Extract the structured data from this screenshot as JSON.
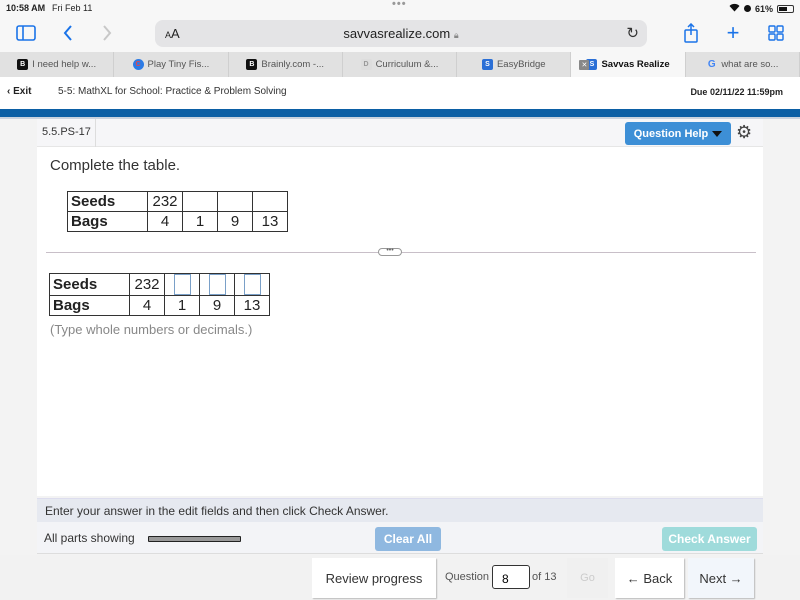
{
  "status_bar": {
    "time": "10:58 AM",
    "date": "Fri Feb 11",
    "battery": "61%",
    "battery_level": 0.61
  },
  "browser": {
    "text_size_label": "AA",
    "url": "savvasrealize.com",
    "icons": {
      "sidebar": "sidebar-icon",
      "back": "chevron-left-icon",
      "forward": "chevron-right-icon",
      "reload": "reload-icon",
      "share": "share-icon",
      "new_tab": "plus-icon",
      "tabs": "tab-grid-icon",
      "lock": "lock-icon"
    },
    "tabs": [
      {
        "label": "I need help w...",
        "favicon": "B",
        "favicon_style": "b",
        "active": false
      },
      {
        "label": "Play Tiny Fis...",
        "favicon": "C",
        "favicon_style": "c",
        "active": false
      },
      {
        "label": "Brainly.com -...",
        "favicon": "B",
        "favicon_style": "b",
        "active": false
      },
      {
        "label": "Curriculum &...",
        "favicon": "D",
        "favicon_style": "d",
        "active": false
      },
      {
        "label": "EasyBridge",
        "favicon": "S",
        "favicon_style": "s",
        "active": false
      },
      {
        "label": "Savvas Realize",
        "favicon": "S",
        "favicon_style": "s",
        "active": true
      },
      {
        "label": "what are so...",
        "favicon": "G",
        "favicon_style": "g",
        "active": false
      }
    ]
  },
  "header": {
    "exit_label": "Exit",
    "assignment_title": "5-5: MathXL for School: Practice & Problem Solving",
    "due": "Due 02/11/22 11:59pm"
  },
  "question": {
    "id": "5.5.PS-17",
    "help_label": "Question Help",
    "prompt": "Complete the table.",
    "given_table": {
      "rows": [
        {
          "label": "Seeds",
          "values": [
            "232",
            "",
            "",
            ""
          ]
        },
        {
          "label": "Bags",
          "values": [
            "4",
            "1",
            "9",
            "13"
          ]
        }
      ]
    },
    "answer_table": {
      "rows": [
        {
          "label": "Seeds",
          "values": [
            "232",
            null,
            null,
            null
          ]
        },
        {
          "label": "Bags",
          "values": [
            "4",
            "1",
            "9",
            "13"
          ]
        }
      ]
    },
    "hint": "(Type whole numbers or decimals.)",
    "expander_label": "•••"
  },
  "instructions": "Enter your answer in the edit fields and then click Check Answer.",
  "status": {
    "parts_label": "All parts showing",
    "clear_all": "Clear All",
    "check_answer": "Check Answer"
  },
  "footer": {
    "review_progress": "Review progress",
    "question_label": "Question",
    "question_number": "8",
    "of_label": "of 13",
    "go": "Go",
    "back": "← Back",
    "next": "Next →"
  },
  "colors": {
    "brand_blue": "#0b5fa5",
    "help_button": "#3d8fd6",
    "clear_all": "#8fb8e0",
    "check_answer": "#9fdbdb"
  }
}
